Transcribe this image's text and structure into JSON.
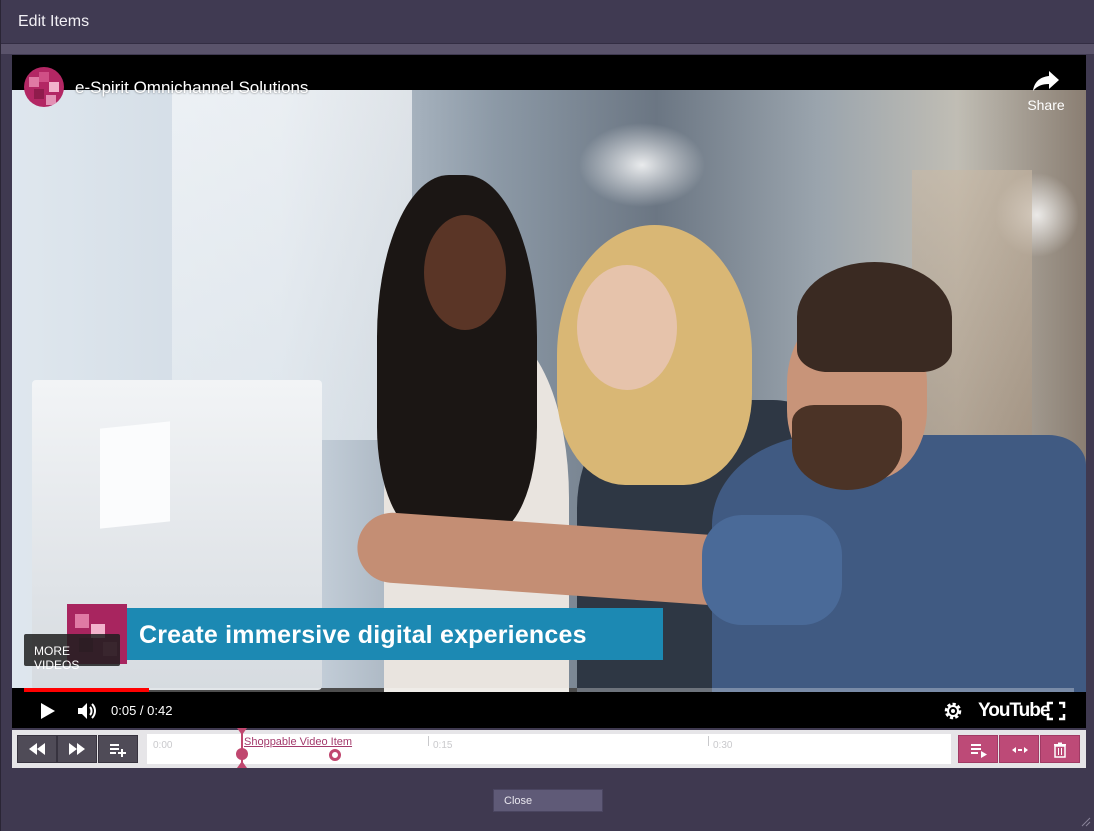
{
  "dialog": {
    "title": "Edit Items"
  },
  "video": {
    "channel_title": "e-Spirit Omnichannel Solutions",
    "share_label": "Share",
    "banner_text": "Create immersive digital experiences",
    "more_videos_label": "MORE VIDEOS",
    "time_display": "0:05 / 0:42",
    "brand_logo": "YouTube",
    "progress": 0.119,
    "icons": [
      "play-icon",
      "volume-icon",
      "settings-gear-icon",
      "fullscreen-icon",
      "share-arrow-icon"
    ]
  },
  "timeline": {
    "ticks": [
      "0:00",
      "0:15",
      "0:30"
    ],
    "item_label": "Shoppable Video Item",
    "left_buttons": [
      "rewind-icon",
      "fast-forward-icon",
      "add-to-list-icon"
    ],
    "right_buttons": [
      "playlist-play-icon",
      "expand-horizontal-icon",
      "trash-icon"
    ]
  },
  "footer": {
    "close_label": "Close"
  },
  "colors": {
    "accent": "#bd4a77",
    "banner": "#1c89b3",
    "progress": "#ff0000",
    "dialog_bg": "#3f3950"
  }
}
